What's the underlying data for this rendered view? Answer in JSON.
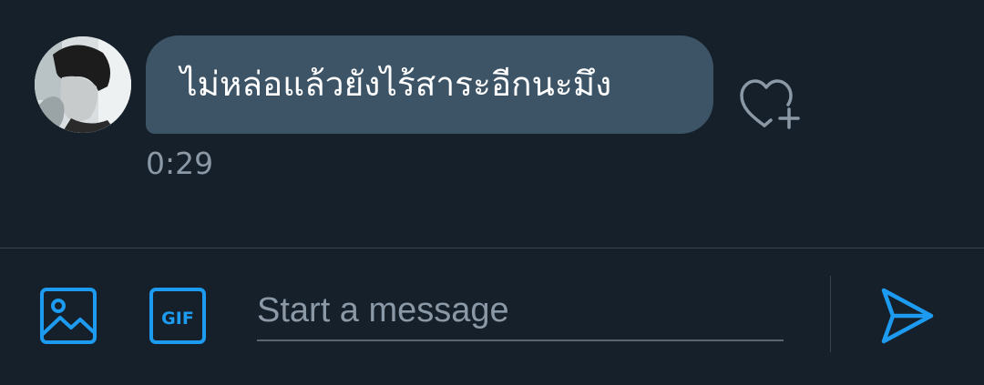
{
  "conversation": {
    "messages": [
      {
        "text": "ไม่หล่อแล้วยังไร้สาระอีกนะมึง",
        "time": "0:29",
        "avatar_icon": "user-avatar-photo",
        "reaction_icon": "heart-plus-icon"
      }
    ]
  },
  "composer": {
    "placeholder": "Start a message",
    "value": "",
    "media_icon": "image-icon",
    "gif_label": "GIF",
    "send_icon": "send-icon"
  },
  "colors": {
    "background": "#15202b",
    "bubble": "#3d5466",
    "accent": "#1d9bf0",
    "muted_text": "#8b98a5",
    "divider": "#38444d"
  }
}
